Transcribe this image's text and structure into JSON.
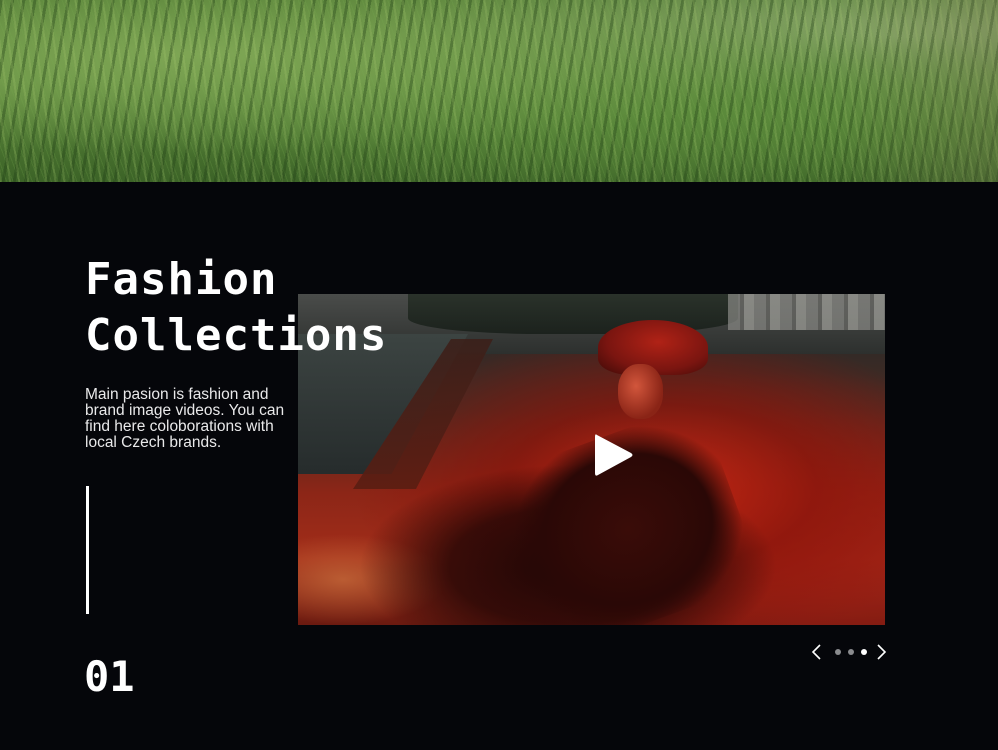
{
  "hero": {
    "image": "grass-field-photo"
  },
  "section": {
    "title_line1": "Fashion",
    "title_line2": "Collections",
    "description_lines": [
      "Main pasion is fashion and",
      "brand image videos. You can",
      "find here coloborations with",
      "local Czech brands."
    ],
    "slide_number": "01"
  },
  "video": {
    "thumbnail": "woman-in-red-light-lying-on-ground",
    "play_icon": "play-icon"
  },
  "slider": {
    "prev_icon": "chevron-left-icon",
    "next_icon": "chevron-right-icon",
    "dot_count": 3,
    "active_dot": 3
  },
  "colors": {
    "background": "#05060a",
    "text": "#ffffff",
    "dot_inactive": "#8a8b8e",
    "dot_active": "#ffffff"
  }
}
